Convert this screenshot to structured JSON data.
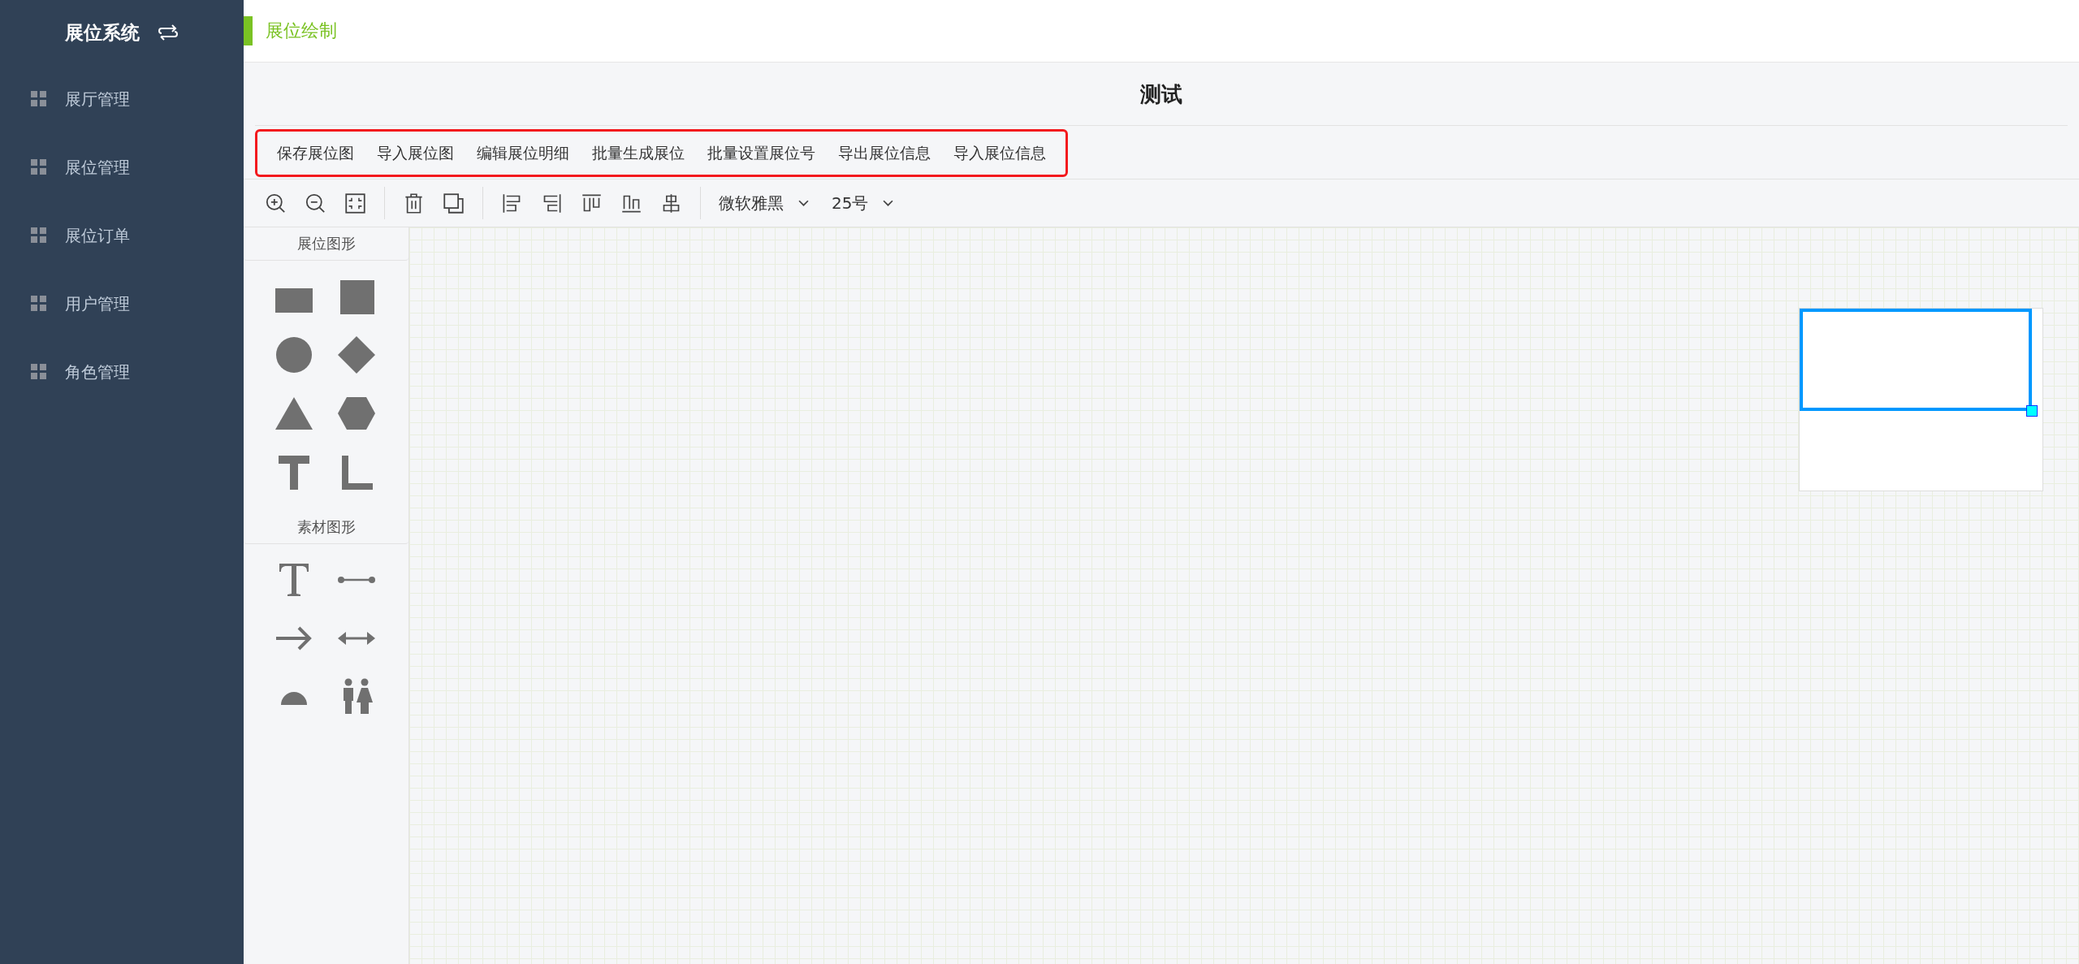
{
  "sidebar": {
    "title": "展位系统",
    "items": [
      {
        "label": "展厅管理"
      },
      {
        "label": "展位管理"
      },
      {
        "label": "展位订单"
      },
      {
        "label": "用户管理"
      },
      {
        "label": "角色管理"
      }
    ]
  },
  "header": {
    "breadcrumb": "展位绘制"
  },
  "page_title": "测试",
  "actions": [
    "保存展位图",
    "导入展位图",
    "编辑展位明细",
    "批量生成展位",
    "批量设置展位号",
    "导出展位信息",
    "导入展位信息"
  ],
  "toolbar": {
    "font": "微软雅黑",
    "font_size": "25号"
  },
  "palette": [
    {
      "title": "展位图形"
    },
    {
      "title": "素材图形"
    }
  ],
  "canvas": {
    "shapes": [
      {
        "kind": "rect",
        "selected": true
      }
    ]
  }
}
